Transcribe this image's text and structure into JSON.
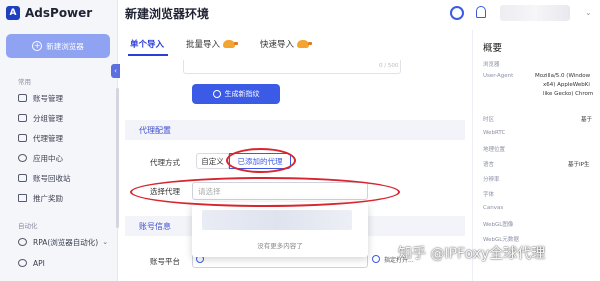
{
  "app": {
    "logo_text": "AdsPower",
    "logo_mark": "A"
  },
  "sidebar": {
    "new_button": "新建浏览器",
    "section_common": "常用",
    "items": [
      {
        "label": "账号管理",
        "icon": "folder-icon"
      },
      {
        "label": "分组管理",
        "icon": "group-icon"
      },
      {
        "label": "代理管理",
        "icon": "proxy-icon"
      },
      {
        "label": "应用中心",
        "icon": "app-center-icon"
      },
      {
        "label": "账号回收站",
        "icon": "trash-icon"
      },
      {
        "label": "推广奖励",
        "icon": "gift-icon"
      }
    ],
    "section_automation": "自动化",
    "automation_items": [
      {
        "label": "RPA(浏览器自动化)",
        "chevron": "⌄"
      },
      {
        "label": "API"
      }
    ],
    "collapse_glyph": "‹"
  },
  "main": {
    "title": "新建浏览器环境",
    "tabs": [
      {
        "label": "单个导入",
        "active": true
      },
      {
        "label": "批量导入",
        "active": false,
        "badge": "duck"
      },
      {
        "label": "快速导入",
        "active": false,
        "badge": "duck"
      }
    ],
    "char_count": "0 / 500",
    "generate_button": "生成新指纹",
    "proxy_section": "代理配置",
    "proxy_mode_label": "代理方式",
    "proxy_mode_options": [
      "自定义",
      "已添加的代理"
    ],
    "select_proxy_label": "选择代理",
    "select_proxy_placeholder": "请选择",
    "dropdown_empty": "没有更多内容了",
    "account_section": "账号信息",
    "platform_label": "账号平台",
    "platform_option_2": "指定打开..."
  },
  "summary": {
    "title": "概要",
    "rows": [
      {
        "label": "浏览器",
        "value": ""
      },
      {
        "label": "User-Agent",
        "value": "Mozilla/5.0 (Window"
      },
      {
        "label": "",
        "value": "x64) AppleWebKi"
      },
      {
        "label": "",
        "value": "like Gecko) Chrom"
      },
      {
        "label": "时区",
        "value": "基于"
      },
      {
        "label": "WebRTC",
        "value": ""
      },
      {
        "label": "地理位置",
        "value": ""
      },
      {
        "label": "语言",
        "value": "基于IP生"
      },
      {
        "label": "分辨率",
        "value": ""
      },
      {
        "label": "字体",
        "value": ""
      },
      {
        "label": "Canvas",
        "value": ""
      },
      {
        "label": "WebGL图像",
        "value": ""
      },
      {
        "label": "WebGL元数据",
        "value": ""
      }
    ]
  },
  "watermark": "知乎 @IPFoxy全球代理",
  "colors": {
    "accent": "#3b5ae6",
    "highlight": "#d8262f",
    "sidebar_bg": "#f5f6fa"
  }
}
